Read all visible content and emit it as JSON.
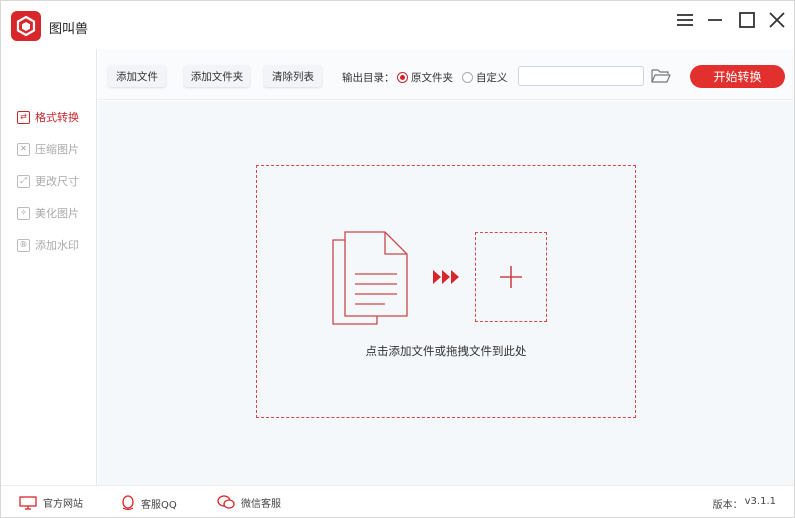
{
  "app": {
    "title": "图叫兽",
    "accent_color": "#d8272b",
    "window_buttons": [
      "menu-icon",
      "minimize-icon",
      "maximize-icon",
      "close-icon"
    ]
  },
  "sidebar": {
    "items": [
      {
        "label": "格式转换",
        "icon": "format-convert-icon",
        "active": true
      },
      {
        "label": "压缩图片",
        "icon": "compress-icon",
        "active": false
      },
      {
        "label": "更改尺寸",
        "icon": "resize-icon",
        "active": false
      },
      {
        "label": "美化图片",
        "icon": "beautify-icon",
        "active": false
      },
      {
        "label": "添加水印",
        "icon": "watermark-icon",
        "active": false
      }
    ]
  },
  "toolbar": {
    "add_file_label": "添加文件",
    "add_folder_label": "添加文件夹",
    "clear_list_label": "清除列表",
    "output_dir_label": "输出目录：",
    "radio_original_label": "原文件夹",
    "radio_custom_label": "自定义",
    "selected_output": "原文件夹",
    "path_value": "",
    "path_placeholder": "",
    "start_label": "开始转换"
  },
  "main": {
    "drop_text": "点击添加文件或拖拽文件到此处"
  },
  "footer": {
    "website_label": "官方网站",
    "qq_label": "客服QQ",
    "wechat_label": "微信客服",
    "version_label": "版本：",
    "version_value": "v3.1.1"
  }
}
